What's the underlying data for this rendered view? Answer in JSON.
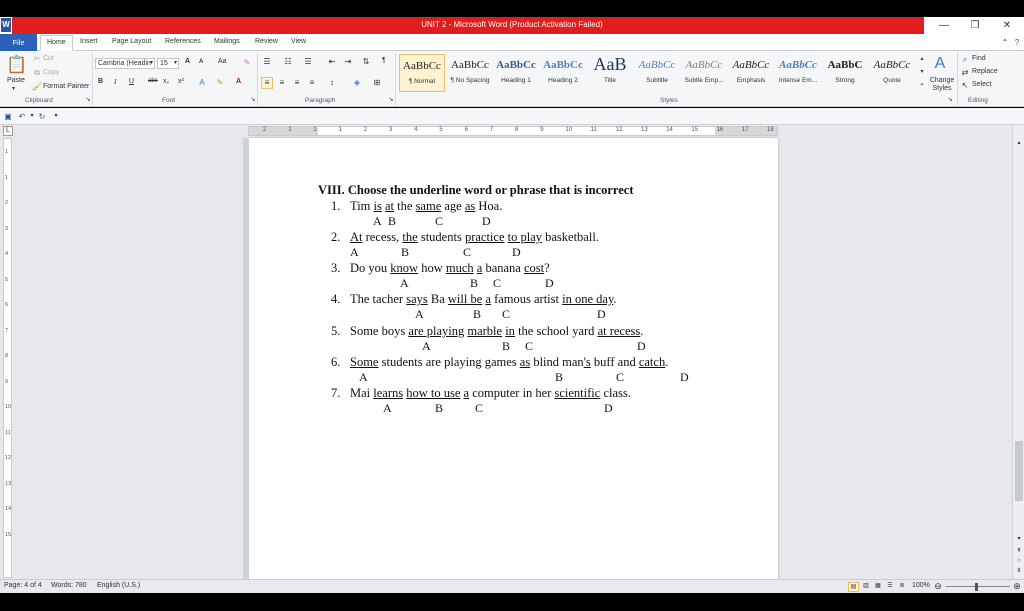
{
  "window": {
    "title": "UNIT 2 - Microsoft Word (Product Activation Failed)",
    "app_letter": "W"
  },
  "ribbon_tabs": [
    "File",
    "Home",
    "Insert",
    "Page Layout",
    "References",
    "Mailings",
    "Review",
    "View"
  ],
  "clipboard": {
    "paste": "Paste",
    "cut": "Cut",
    "copy": "Copy",
    "format_painter": "Format Painter",
    "label": "Clipboard"
  },
  "font": {
    "name": "Cambria (Headin",
    "size": "15",
    "label": "Font",
    "bold": "B",
    "italic": "I",
    "underline": "U",
    "strike": "abc",
    "sub": "x₂",
    "sup": "x²",
    "change_case": "Aa",
    "grow": "A",
    "shrink": "A",
    "font_color": "A"
  },
  "paragraph": {
    "label": "Paragraph",
    "pilcrow": "¶"
  },
  "styles": {
    "label": "Styles",
    "items": [
      {
        "preview": "AaBbCc",
        "name": "¶ Normal"
      },
      {
        "preview": "AaBbCc",
        "name": "¶ No Spacing"
      },
      {
        "preview": "AaBbCc",
        "name": "Heading 1"
      },
      {
        "preview": "AaBbCc",
        "name": "Heading 2"
      },
      {
        "preview": "AaB",
        "name": "Title"
      },
      {
        "preview": "AaBbCc",
        "name": "Subtitle"
      },
      {
        "preview": "AaBbCc",
        "name": "Subtle Emp..."
      },
      {
        "preview": "AaBbCc",
        "name": "Emphasis"
      },
      {
        "preview": "AaBbCc",
        "name": "Intense Em..."
      },
      {
        "preview": "AaBbC",
        "name": "Strong"
      },
      {
        "preview": "AaBbCc",
        "name": "Quote"
      }
    ],
    "change_styles": "Change Styles"
  },
  "editing": {
    "find": "Find",
    "replace": "Replace",
    "select": "Select",
    "label": "Editing"
  },
  "document": {
    "heading": "VIII. Choose the underline word or phrase that is incorrect",
    "questions": [
      {
        "num": "1.",
        "parts": [
          [
            "Tim ",
            false
          ],
          [
            "is",
            true
          ],
          [
            " ",
            false
          ],
          [
            "at",
            true
          ],
          [
            " the ",
            false
          ],
          [
            "same",
            true
          ],
          [
            " age ",
            false
          ],
          [
            "as",
            true
          ],
          [
            " Hoa.",
            false
          ]
        ],
        "letters": [
          "A",
          "B",
          "C",
          "D"
        ]
      },
      {
        "num": "2.",
        "parts": [
          [
            "At",
            true
          ],
          [
            " recess, ",
            false
          ],
          [
            "the",
            true
          ],
          [
            " students ",
            false
          ],
          [
            "practice",
            true
          ],
          [
            " ",
            false
          ],
          [
            "to play",
            true
          ],
          [
            " basketball.",
            false
          ]
        ],
        "letters": [
          "A",
          "B",
          "C",
          "D"
        ]
      },
      {
        "num": "3.",
        "parts": [
          [
            " Do you ",
            false
          ],
          [
            "know",
            true
          ],
          [
            " how ",
            false
          ],
          [
            "much",
            true
          ],
          [
            " ",
            false
          ],
          [
            "a",
            true
          ],
          [
            " banana ",
            false
          ],
          [
            "cost",
            true
          ],
          [
            "?",
            false
          ]
        ],
        "letters": [
          "A",
          "B",
          "C",
          "D"
        ]
      },
      {
        "num": "4.",
        "parts": [
          [
            "The tacher ",
            false
          ],
          [
            "says",
            true
          ],
          [
            " Ba ",
            false
          ],
          [
            "will be",
            true
          ],
          [
            " ",
            false
          ],
          [
            "a",
            true
          ],
          [
            " famous artist ",
            false
          ],
          [
            "in one day",
            true
          ],
          [
            ".",
            false
          ]
        ],
        "letters": [
          "A",
          "B",
          "C",
          "D"
        ]
      },
      {
        "num": "5.",
        "parts": [
          [
            "Some boys ",
            false
          ],
          [
            "are playing",
            true
          ],
          [
            " ",
            false
          ],
          [
            "marble",
            true
          ],
          [
            " ",
            false
          ],
          [
            "in",
            true
          ],
          [
            " the school yard ",
            false
          ],
          [
            "at recess",
            true
          ],
          [
            ".",
            false
          ]
        ],
        "letters": [
          "A",
          "B",
          "C",
          "D"
        ]
      },
      {
        "num": "6.",
        "parts": [
          [
            "Some",
            true
          ],
          [
            " students are playing games ",
            false
          ],
          [
            "as",
            true
          ],
          [
            " blind man",
            false
          ],
          [
            "'s",
            true
          ],
          [
            " buff and ",
            false
          ],
          [
            "catch",
            true
          ],
          [
            ".",
            false
          ]
        ],
        "letters": [
          "A",
          "B",
          "C",
          "D"
        ]
      },
      {
        "num": "7.",
        "parts": [
          [
            "Mai ",
            false
          ],
          [
            "learns",
            true
          ],
          [
            " ",
            false
          ],
          [
            "how to use",
            true
          ],
          [
            " ",
            false
          ],
          [
            "a",
            true
          ],
          [
            " computer in her ",
            false
          ],
          [
            "scientific",
            true
          ],
          [
            " class.",
            false
          ]
        ],
        "letters": [
          "A",
          "B",
          "C",
          "D"
        ]
      }
    ]
  },
  "ruler_numbers": [
    "2",
    "1",
    "1",
    "1",
    "2",
    "3",
    "4",
    "5",
    "6",
    "7",
    "8",
    "9",
    "10",
    "11",
    "12",
    "13",
    "14",
    "15",
    "16",
    "17",
    "18"
  ],
  "vruler_numbers": [
    "1",
    "1",
    "2",
    "3",
    "4",
    "5",
    "6",
    "7",
    "8",
    "9",
    "10",
    "11",
    "12",
    "13",
    "14",
    "15"
  ],
  "status": {
    "page": "Page: 4 of 4",
    "words": "Words: 780",
    "language": "English (U.S.)",
    "zoom": "100%"
  }
}
